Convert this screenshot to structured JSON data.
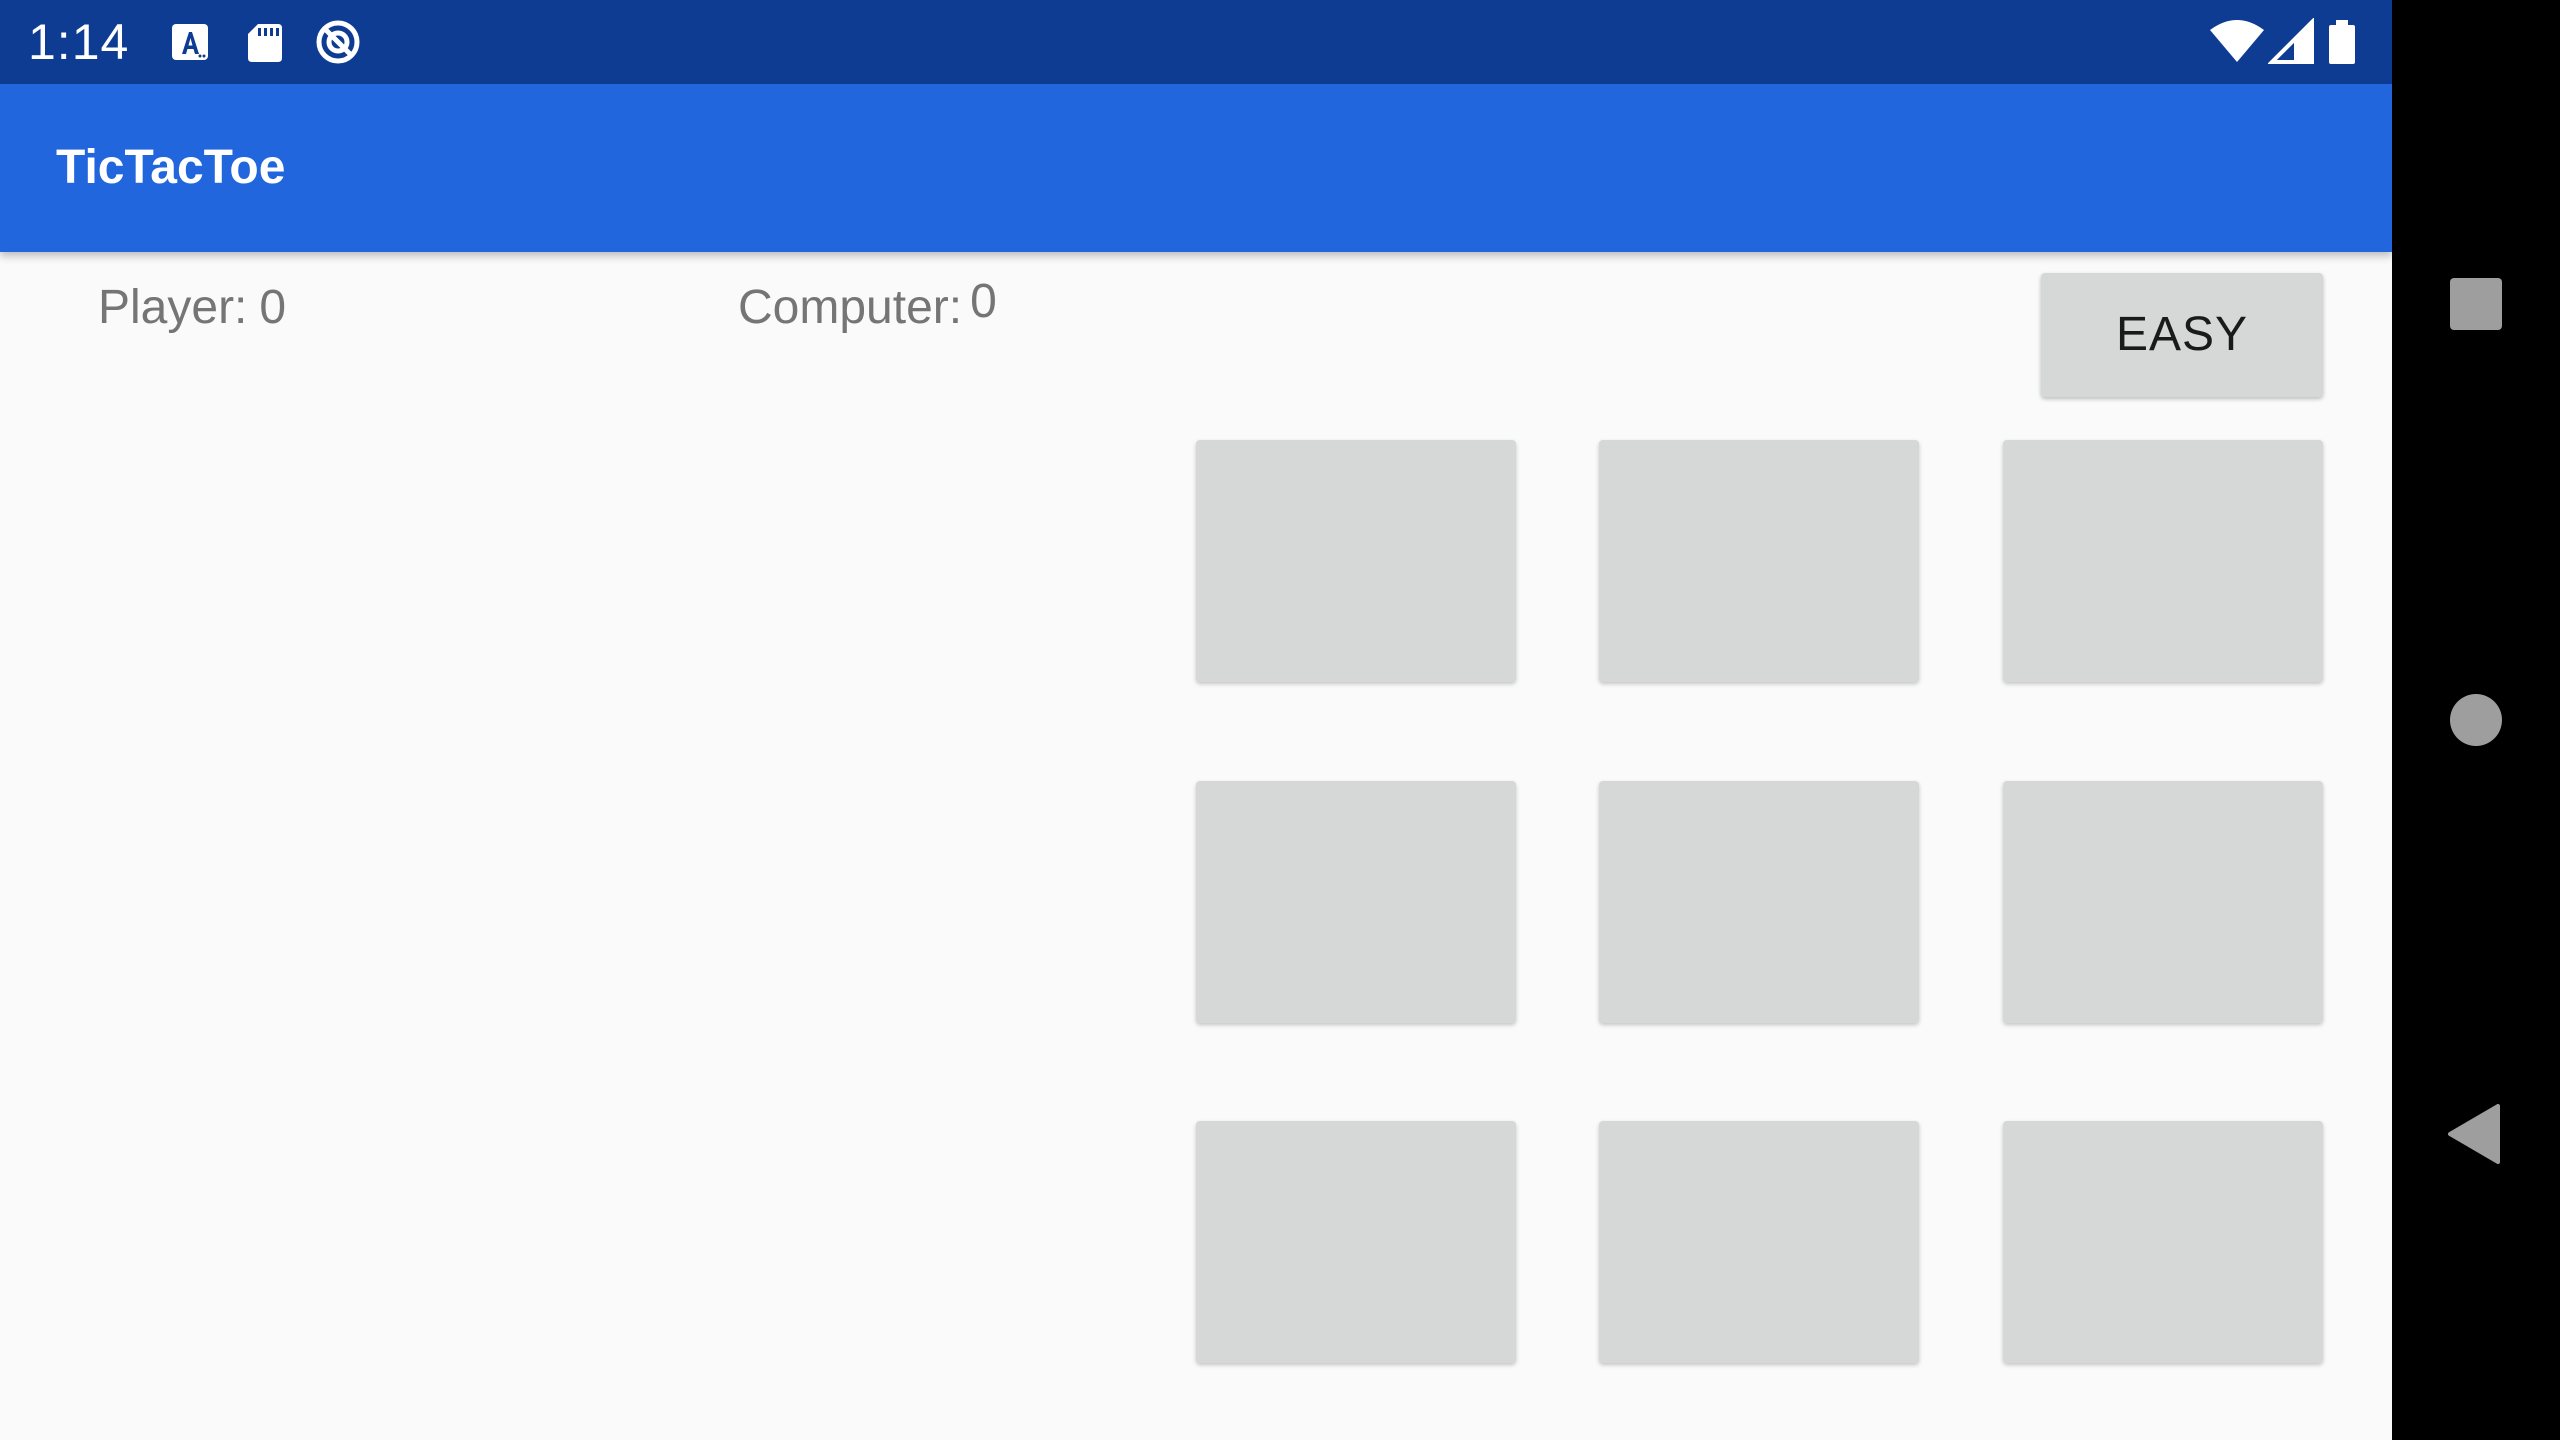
{
  "status_bar": {
    "time": "1:14",
    "left_icons": [
      "a-notification-icon",
      "sd-card-icon",
      "no-disturb-icon"
    ],
    "right_icons": [
      "wifi-icon",
      "signal-icon",
      "battery-icon"
    ]
  },
  "app_bar": {
    "title": "TicTacToe"
  },
  "scores": {
    "player_label": "Player:",
    "player_value": "0",
    "computer_label": "Computer:",
    "computer_value": "0"
  },
  "difficulty_button": {
    "label": "EASY"
  },
  "board": {
    "cells": [
      "",
      "",
      "",
      "",
      "",
      "",
      "",
      "",
      ""
    ]
  },
  "nav_bar": {
    "buttons": [
      "recents-button",
      "home-button",
      "back-button"
    ]
  },
  "colors": {
    "status_bar": "#0f3c93",
    "app_bar": "#2166dc",
    "background": "#fafafa",
    "cell": "#d6d7d7",
    "score_text": "#757575"
  }
}
